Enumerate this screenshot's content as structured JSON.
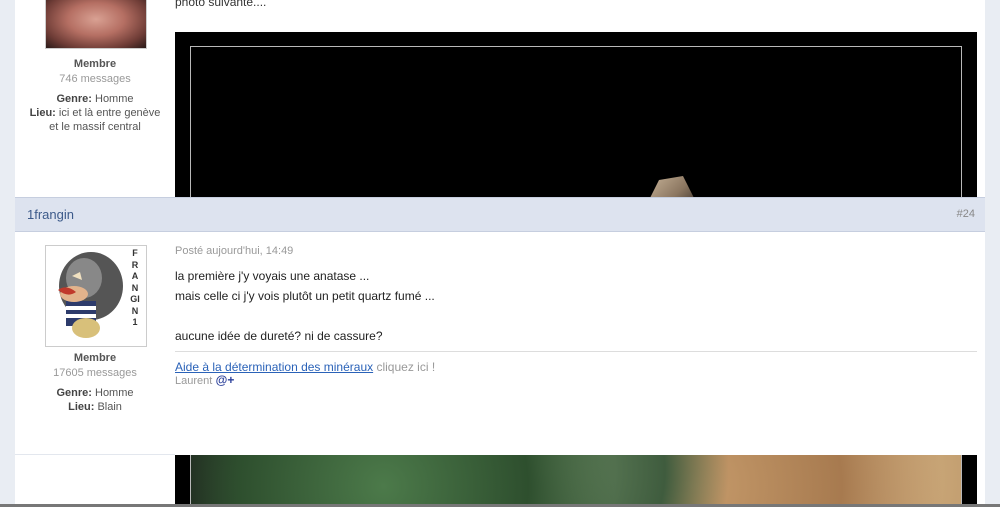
{
  "previous_post": {
    "text_fragment": "photo suivante....",
    "user": {
      "role": "Membre",
      "messages": "746 messages",
      "gender_label": "Genre:",
      "gender_value": "Homme",
      "location_label": "Lieu:",
      "location_value": "ici et là entre genève et le massif central"
    }
  },
  "post": {
    "author": "1frangin",
    "number": "#24",
    "posted": "Posté aujourd'hui, 14:49",
    "lines": [
      "la première j'y voyais une anatase ...",
      "mais celle ci j'y vois plutôt un petit quartz fumé ...",
      "",
      "aucune idée de dureté? ni de cassure?"
    ],
    "user": {
      "avatar_letters": "FRANGIN1",
      "role": "Membre",
      "messages": "17605 messages",
      "gender_label": "Genre:",
      "gender_value": "Homme",
      "location_label": "Lieu:",
      "location_value": "Blain"
    },
    "signature": {
      "link": "Aide à la détermination des minéraux",
      "hint": "cliquez ici !",
      "name": "Laurent",
      "at": "@+"
    }
  }
}
